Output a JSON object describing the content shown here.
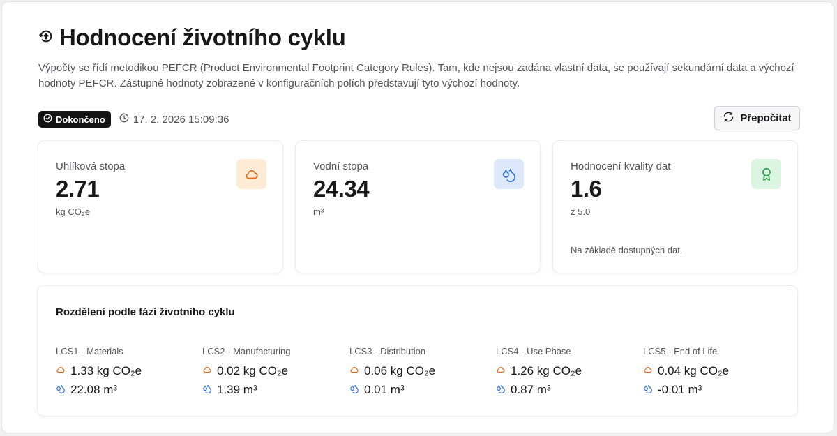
{
  "header": {
    "title": "Hodnocení životního cyklu",
    "description": "Výpočty se řídí metodikou PEFCR (Product Environmental Footprint Category Rules). Tam, kde nejsou zadána vlastní data, se používají sekundární data a výchozí hodnoty PEFCR. Zástupné hodnoty zobrazené v konfiguračních polích představují tyto výchozí hodnoty.",
    "icon": "refresh-circle-icon"
  },
  "status": {
    "badge_label": "Dokončeno",
    "timestamp": "17. 2. 2026 15:09:36"
  },
  "actions": {
    "recalculate_label": "Přepočítat"
  },
  "colors": {
    "carbon_accent": "#e0661a",
    "carbon_bg": "#fdebd6",
    "water_accent": "#2f6fd6",
    "water_bg": "#dde8fb",
    "quality_accent": "#2a9d48",
    "quality_bg": "#dcf5e2"
  },
  "cards": {
    "carbon": {
      "label": "Uhlíková stopa",
      "value": "2.71",
      "unit": "kg CO₂e",
      "icon": "cloud-icon"
    },
    "water": {
      "label": "Vodní stopa",
      "value": "24.34",
      "unit": "m³",
      "icon": "droplets-icon"
    },
    "quality": {
      "label": "Hodnocení kvality dat",
      "value": "1.6",
      "unit": "z 5.0",
      "note": "Na základě dostupných dat.",
      "icon": "award-icon"
    }
  },
  "stages": {
    "title": "Rozdělení podle fází životního cyklu",
    "items": [
      {
        "label": "LCS1 - Materials",
        "carbon": "1.33 kg CO₂e",
        "water": "22.08 m³"
      },
      {
        "label": "LCS2 - Manufacturing",
        "carbon": "0.02 kg CO₂e",
        "water": "1.39 m³"
      },
      {
        "label": "LCS3 - Distribution",
        "carbon": "0.06 kg CO₂e",
        "water": "0.01 m³"
      },
      {
        "label": "LCS4 - Use Phase",
        "carbon": "1.26 kg CO₂e",
        "water": "0.87 m³"
      },
      {
        "label": "LCS5 - End of Life",
        "carbon": "0.04 kg CO₂e",
        "water": "-0.01 m³"
      }
    ]
  }
}
